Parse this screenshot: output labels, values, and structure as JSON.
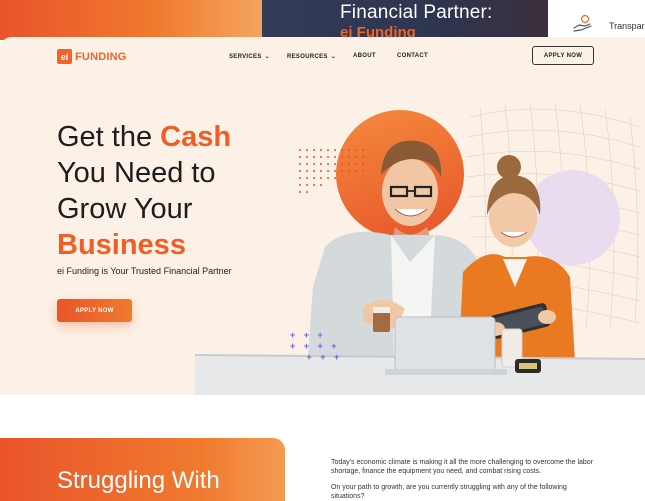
{
  "background": {
    "middle_title": "Financial Partner:",
    "middle_subtitle": "ei Funding",
    "right_text": "Transpare"
  },
  "brand": {
    "logo_mark": "ei",
    "logo_text": "FUNDING",
    "accent_color": "#ef5f25"
  },
  "nav": {
    "services": "SERVICES",
    "resources": "RESOURCES",
    "about": "ABOUT",
    "contact": "CONTACT",
    "apply_button": "APPLY NOW"
  },
  "hero": {
    "headline_line1_plain": "Get the ",
    "headline_line1_accent": "Cash",
    "headline_line2": "You Need to",
    "headline_line3": "Grow Your",
    "headline_line4_accent": "Business",
    "subline": "ei Funding is Your Trusted Financial Partner",
    "cta_label": "APPLY NOW"
  },
  "section2": {
    "title": "Struggling With",
    "paragraph1": "Today's economic climate is making it all the more challenging to overcome the labor shortage, finance the equipment you need, and combat rising costs.",
    "paragraph2": "On your path to growth, are you currently struggling with any of the following situations?"
  }
}
